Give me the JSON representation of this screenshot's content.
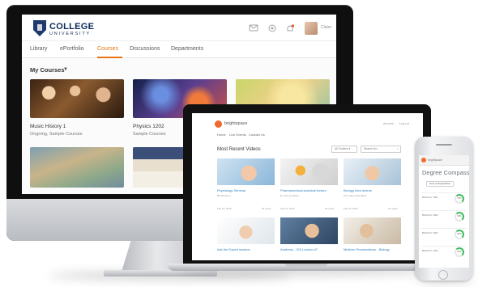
{
  "imac": {
    "logo": {
      "title": "COLLEGE",
      "subtitle": "UNIVERSITY"
    },
    "user_name": "Claire",
    "nav": [
      "Library",
      "ePortfolio",
      "Courses",
      "Discussions",
      "Departments"
    ],
    "active_nav": "Courses",
    "courses_heading": "My Courses",
    "courses": [
      {
        "title": "Music History 1",
        "subtitle": "Ongoing, Sample Courses"
      },
      {
        "title": "Physics 1202",
        "subtitle": "Sample Courses"
      }
    ]
  },
  "laptop": {
    "brand": "brightspace",
    "right_links": [
      "Account",
      "Log out"
    ],
    "nav": [
      "Home",
      "Live Events",
      "Contact Us"
    ],
    "heading": "Most Recent Videos",
    "filter": "All Folders",
    "search_placeholder": "Search for...",
    "videos": [
      {
        "title": "Physiology Seminar",
        "author": "Bill Morrison",
        "date": "Feb 10, 2016",
        "views": "18 views"
      },
      {
        "title": "Pharmaceutical practical lecture",
        "author": "Dr. Denny Ashley",
        "date": "Feb 11, 2016",
        "views": "44 views"
      },
      {
        "title": "Biology intro lecture",
        "author": "Prof. Alice Greenfield",
        "date": "Feb 15, 2016",
        "views": "22 views"
      },
      {
        "title": "Ask the Expert session",
        "author": "",
        "date": "",
        "views": ""
      },
      {
        "title": "Anatomy - 323 Lecture #7",
        "author": "",
        "date": "",
        "views": ""
      },
      {
        "title": "Midterm Presentations - Biology",
        "author": "",
        "date": "",
        "views": ""
      }
    ]
  },
  "phone": {
    "brand": "brightspace",
    "title": "Degree Compass",
    "button": "How to Registration",
    "rows": [
      {
        "label": "BIOLOGY 1001",
        "value": "97%"
      },
      {
        "label": "BIOLOGY 1002",
        "value": "90%"
      },
      {
        "label": "BIOLOGY 1003",
        "value": "84%"
      },
      {
        "label": "BIOLOGY 1004",
        "value": "81%"
      }
    ]
  },
  "colors": {
    "accent": "#e87511",
    "brightspace": "#f26a2b",
    "link": "#2d7fc1",
    "navy": "#0b2a5b",
    "gauge": "#3dbb5a"
  }
}
